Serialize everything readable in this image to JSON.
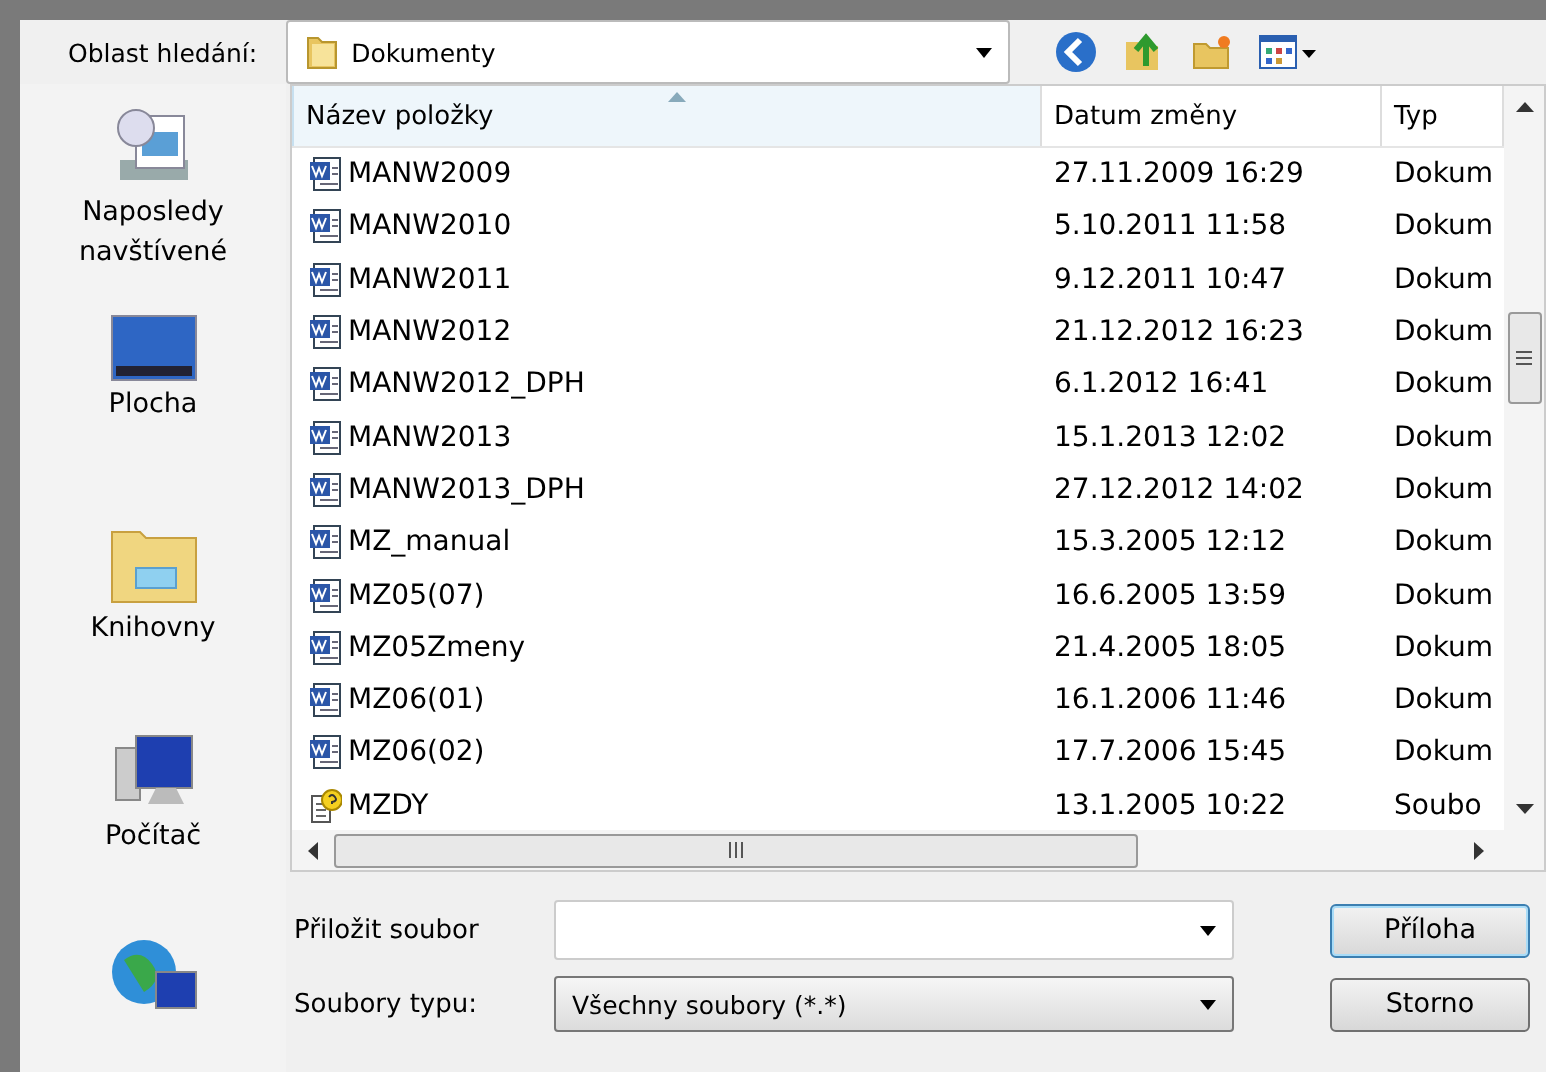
{
  "lookin": {
    "label": "Oblast hledání:",
    "value": "Dokumenty"
  },
  "places": [
    {
      "kind": "recent",
      "label": "Naposledy navštívené"
    },
    {
      "kind": "desktop",
      "label": "Plocha"
    },
    {
      "kind": "libraries",
      "label": "Knihovny"
    },
    {
      "kind": "computer",
      "label": "Počítač"
    },
    {
      "kind": "network"
    }
  ],
  "table": {
    "columns": [
      {
        "label": "Název položky",
        "sorted": true
      },
      {
        "label": "Datum změny",
        "sorted": false
      },
      {
        "label": "Typ",
        "sorted": false
      }
    ],
    "rows": [
      {
        "kind": "word",
        "name": "MANW2009",
        "date": "27.11.2009 16:29",
        "type": "Dokum"
      },
      {
        "kind": "word",
        "name": "MANW2010",
        "date": "5.10.2011 11:58",
        "type": "Dokum"
      },
      {
        "kind": "word",
        "name": "MANW2011",
        "date": "9.12.2011 10:47",
        "type": "Dokum"
      },
      {
        "kind": "word",
        "name": "MANW2012",
        "date": "21.12.2012 16:23",
        "type": "Dokum"
      },
      {
        "kind": "word",
        "name": "MANW2012_DPH",
        "date": "6.1.2012 16:41",
        "type": "Dokum"
      },
      {
        "kind": "word",
        "name": "MANW2013",
        "date": "15.1.2013 12:02",
        "type": "Dokum"
      },
      {
        "kind": "word",
        "name": "MANW2013_DPH",
        "date": "27.12.2012 14:02",
        "type": "Dokum"
      },
      {
        "kind": "word",
        "name": "MZ_manual",
        "date": "15.3.2005 12:12",
        "type": "Dokum"
      },
      {
        "kind": "word",
        "name": "MZ05(07)",
        "date": "16.6.2005 13:59",
        "type": "Dokum"
      },
      {
        "kind": "word",
        "name": "MZ05Zmeny",
        "date": "21.4.2005 18:05",
        "type": "Dokum"
      },
      {
        "kind": "word",
        "name": "MZ06(01)",
        "date": "16.1.2006 11:46",
        "type": "Dokum"
      },
      {
        "kind": "word",
        "name": "MZ06(02)",
        "date": "17.7.2006 15:45",
        "type": "Dokum"
      },
      {
        "kind": "unknown",
        "name": "MZDY",
        "date": "13.1.2005 10:22",
        "type": "Soubo"
      }
    ]
  },
  "filename": {
    "label": "Přiložit soubor"
  },
  "filetype": {
    "label": "Soubory typu:",
    "value": "Všechny soubory (*.*)"
  },
  "buttons": [
    {
      "label": "Příloha",
      "default": true
    },
    {
      "label": "Storno",
      "default": false
    }
  ]
}
